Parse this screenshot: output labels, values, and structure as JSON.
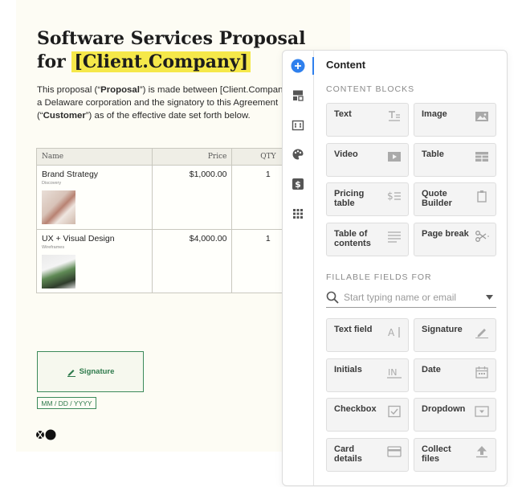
{
  "document": {
    "title_line1": "Software Services Proposal",
    "title_for": "for",
    "title_company": "[Client.Company]",
    "intro": {
      "part1": "This proposal (“",
      "proposal_bold": "Proposal",
      "part2": "”) is made between [Client.Compan",
      "line2": "a Delaware corporation and the signatory to this Agreement",
      "part3": "(“",
      "customer_bold": "Customer",
      "part4": "”) as of the effective date set forth below."
    },
    "table": {
      "headers": {
        "name": "Name",
        "price": "Price",
        "qty": "QTY"
      },
      "rows": [
        {
          "name": "Brand Strategy",
          "sub": "Discovery",
          "price": "$1,000.00",
          "qty": "1"
        },
        {
          "name": "UX + Visual Design",
          "sub": "Wireframes",
          "price": "$4,000.00",
          "qty": "1"
        }
      ]
    },
    "signature_label": "Signature",
    "date_placeholder": "MM / DD / YYYY"
  },
  "panel": {
    "title": "Content",
    "content_blocks_label": "CONTENT BLOCKS",
    "content_blocks": [
      {
        "label": "Text",
        "icon": "text-icon"
      },
      {
        "label": "Image",
        "icon": "image-icon"
      },
      {
        "label": "Video",
        "icon": "video-icon"
      },
      {
        "label": "Table",
        "icon": "table-icon"
      },
      {
        "label": "Pricing table",
        "icon": "pricing-table-icon"
      },
      {
        "label": "Quote Builder",
        "icon": "clipboard-icon"
      },
      {
        "label": "Table of contents",
        "icon": "list-icon"
      },
      {
        "label": "Page break",
        "icon": "scissors-icon"
      }
    ],
    "fillable_label": "FILLABLE FIELDS FOR",
    "search_placeholder": "Start typing name or email",
    "fillable_fields": [
      {
        "label": "Text field",
        "icon": "text-field-icon"
      },
      {
        "label": "Signature",
        "icon": "pen-icon"
      },
      {
        "label": "Initials",
        "icon": "initials-icon"
      },
      {
        "label": "Date",
        "icon": "calendar-icon"
      },
      {
        "label": "Checkbox",
        "icon": "checkbox-icon"
      },
      {
        "label": "Dropdown",
        "icon": "dropdown-icon"
      },
      {
        "label": "Card details",
        "icon": "card-icon"
      },
      {
        "label": "Collect files",
        "icon": "upload-icon"
      }
    ],
    "rail_icons": [
      "add-icon",
      "blocks-icon",
      "embed-icon",
      "palette-icon",
      "dollar-icon",
      "grid-icon"
    ]
  },
  "colors": {
    "highlight": "#f5e84a",
    "accent_blue": "#2f80ed",
    "signature_green": "#2e7a4c",
    "doc_background": "#fdfcf4"
  }
}
